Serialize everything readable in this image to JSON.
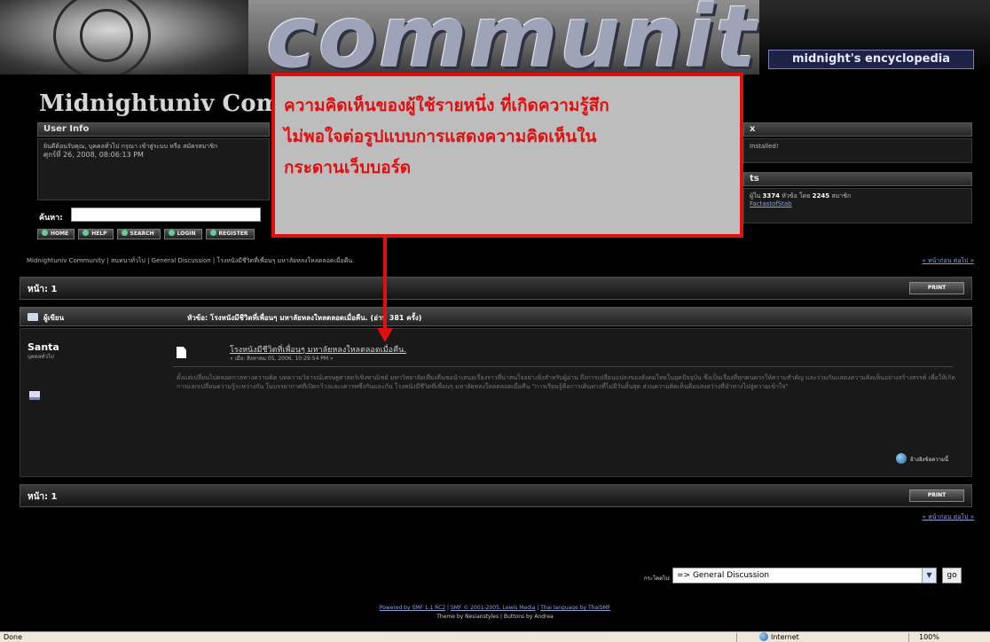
{
  "banner": {
    "word": "community",
    "tagline": "midnight's encyclopedia"
  },
  "site_title": "Midnightuniv Comn",
  "user_info": {
    "heading": "User Info",
    "line1": "ยินดีต้อนรับคุณ, บุคคลทั่วไป กรุณา เข้าสู่ระบบ หรือ สมัครสมาชิก",
    "line2": "ศุกร์ที่ 26, 2008, 08:06:13 PM"
  },
  "news_box": {
    "heading": "x",
    "text": "Installed!"
  },
  "stats_box": {
    "heading": "ts",
    "text_prefix": "ผู้ใน",
    "posts": "3374",
    "text_mid": "หัวข้อ โดย",
    "members": "2245",
    "text_suffix": "สมาชิก",
    "latest": "FactastofStab"
  },
  "search": {
    "label": "ค้นหา:"
  },
  "nav": {
    "buttons": [
      "HOME",
      "HELP",
      "SEARCH",
      "LOGIN",
      "REGISTER"
    ]
  },
  "breadcrumb": {
    "text": "Midnightuniv Community  |  สนทนาทั่วไป  |  General Discussion  |  โรงหนังมีชีวิตที่เพื่อนๆ มหาลัยหลงใหลตลอดเมื่อคืน.",
    "right": "« หน้าก่อน  ต่อไป »"
  },
  "page_bar": {
    "label": "หน้า: 1",
    "print": "PRINT"
  },
  "thread": {
    "author_col": "ผู้เขียน",
    "topic": "หัวข้อ: โรงหนังมีชีวิตที่เพื่อนๆ มหาลัยหลงใหลตลอดเมื่อคืน.  (อ่าน 381 ครั้ง)"
  },
  "post": {
    "poster_name": "Santa",
    "poster_rank": "บุคคลทั่วไป",
    "title": "โรงหนังมีชีวิตที่เพื่อนๆ มหาลัยหลงใหลตลอดเมื่อคืน.",
    "date": "« เมื่อ: สิงหาคม 05, 2006, 10:29:54 PM »",
    "body": "ตั้งแต่เปลี่ยนไปตลอดกาลทางความคิด บทความวิจารณ์เศรษฐศาสตร์เชิงพาณิชย์ มหาวิทยาลัยเที่ยงคืนขอนำเสนอเรื่องราวที่น่าสนใจอย่างยิ่งสำหรับผู้อ่าน ถึงการเปลี่ยนแปลงของสังคมไทยในยุคปัจจุบัน ซึ่งเป็นเรื่องที่ทุกคนควรให้ความสำคัญ และร่วมกันแสดงความคิดเห็นอย่างสร้างสรรค์ เพื่อให้เกิดการแลกเปลี่ยนความรู้ระหว่างกัน ในบรรยากาศที่เปิดกว้างและเคารพซึ่งกันและกัน โรงหนังมีชีวิตที่เพื่อนๆ มหาลัยหลงใหลตลอดเมื่อคืน \"การเรียนรู้คือการเดินทางที่ไม่มีวันสิ้นสุด ส่วนความคิดเห็นคือแสงสว่างที่นำทางไปสู่ความเข้าใจ\"",
    "reply_quote": "อ้างอิงข้อความนี้"
  },
  "page_bar2": {
    "label": "หน้า: 1",
    "print": "PRINT",
    "right": "« หน้าก่อน  ต่อไป »"
  },
  "jump": {
    "label": "กระโดดไป:",
    "selected": "=> General Discussion",
    "go": "go"
  },
  "footer": {
    "powered": "Powered by SMF 1.1 RC2",
    "smf": "SMF © 2001-2005, Lewis Media",
    "thai": "Thai language by ThaiSMF",
    "theme": "Theme by Nesianstyles | Buttons by Andrea"
  },
  "callout": {
    "line1": "ความคิดเห็นของผู้ใช้รายหนึ่ง ที่เกิดความรู้สึก",
    "line2": "ไม่พอใจต่อรูปแบบการแสดงความคิดเห็นใน",
    "line3": "กระดานเว็บบอร์ด"
  },
  "statusbar": {
    "done": "Done",
    "zone": "Internet",
    "zoom": "100%"
  }
}
